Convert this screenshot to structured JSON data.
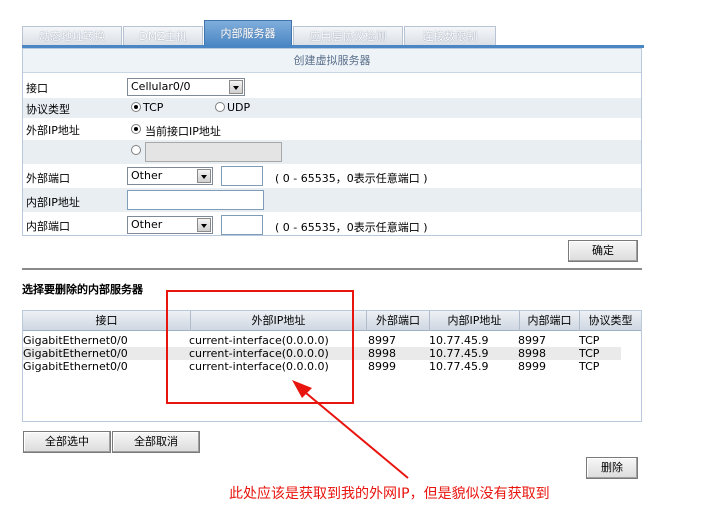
{
  "tabs": [
    {
      "label": "动态地址转换",
      "active": false
    },
    {
      "label": "DMZ主机",
      "active": false
    },
    {
      "label": "内部服务器",
      "active": true
    },
    {
      "label": "应用层协议检测",
      "active": false
    },
    {
      "label": "连接数限制",
      "active": false
    }
  ],
  "form": {
    "header": "创建虚拟服务器",
    "interface_label": "接口",
    "interface_value": "Cellular0/0",
    "protocol_label": "协议类型",
    "protocol_tcp": "TCP",
    "protocol_udp": "UDP",
    "ext_ip_label": "外部IP地址",
    "ext_ip_option_current": "当前接口IP地址",
    "ext_port_label": "外部端口",
    "ext_port_select": "Other",
    "ext_port_hint": "( 0 - 65535，0表示任意端口 )",
    "int_ip_label": "内部IP地址",
    "int_port_label": "内部端口",
    "int_port_select": "Other",
    "int_port_hint": "( 0 - 65535，0表示任意端口 )",
    "confirm_button": "确定"
  },
  "delete_section": {
    "title": "选择要删除的内部服务器",
    "columns": [
      "接口",
      "外部IP地址",
      "外部端口",
      "内部IP地址",
      "内部端口",
      "协议类型"
    ],
    "rows": [
      [
        "GigabitEthernet0/0",
        "current-interface(0.0.0.0)",
        "8997",
        "10.77.45.9",
        "8997",
        "TCP"
      ],
      [
        "GigabitEthernet0/0",
        "current-interface(0.0.0.0)",
        "8998",
        "10.77.45.9",
        "8998",
        "TCP"
      ],
      [
        "GigabitEthernet0/0",
        "current-interface(0.0.0.0)",
        "8999",
        "10.77.45.9",
        "8999",
        "TCP"
      ]
    ],
    "select_all_button": "全部选中",
    "deselect_all_button": "全部取消",
    "delete_button": "删除"
  },
  "annotation": {
    "text": "此处应该是获取到我的外网IP，但是貌似没有获取到",
    "color": "#e8140e"
  }
}
